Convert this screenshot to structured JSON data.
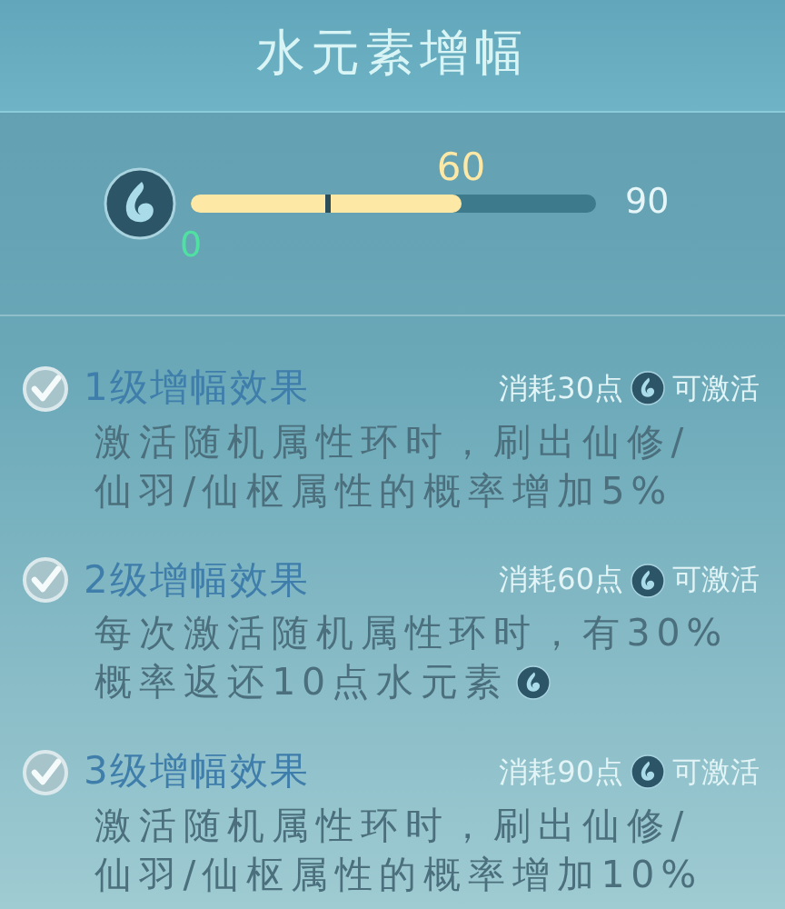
{
  "title": "水元素增幅",
  "progress": {
    "level": 0.667,
    "min_label": "0",
    "value_label": "60",
    "max_label": "90"
  },
  "effects": [
    {
      "checked": true,
      "title": "1级增幅效果",
      "cost_prefix": "消耗30点",
      "cost_suffix": "可激活",
      "lines": [
        "激活随机属性环时，刷出仙修/",
        "仙羽/仙枢属性的概率增加5%"
      ],
      "desc_icon": false
    },
    {
      "checked": true,
      "title": "2级增幅效果",
      "cost_prefix": "消耗60点",
      "cost_suffix": "可激活",
      "lines": [
        "每次激活随机属性环时，有30%",
        "概率返还10点水元素"
      ],
      "desc_icon": true
    },
    {
      "checked": true,
      "title": "3级增幅效果",
      "cost_prefix": "消耗90点",
      "cost_suffix": "可激活",
      "lines": [
        "激活随机属性环时，刷出仙修/",
        "仙羽/仙枢属性的概率增加10%"
      ],
      "desc_icon": false
    }
  ]
}
